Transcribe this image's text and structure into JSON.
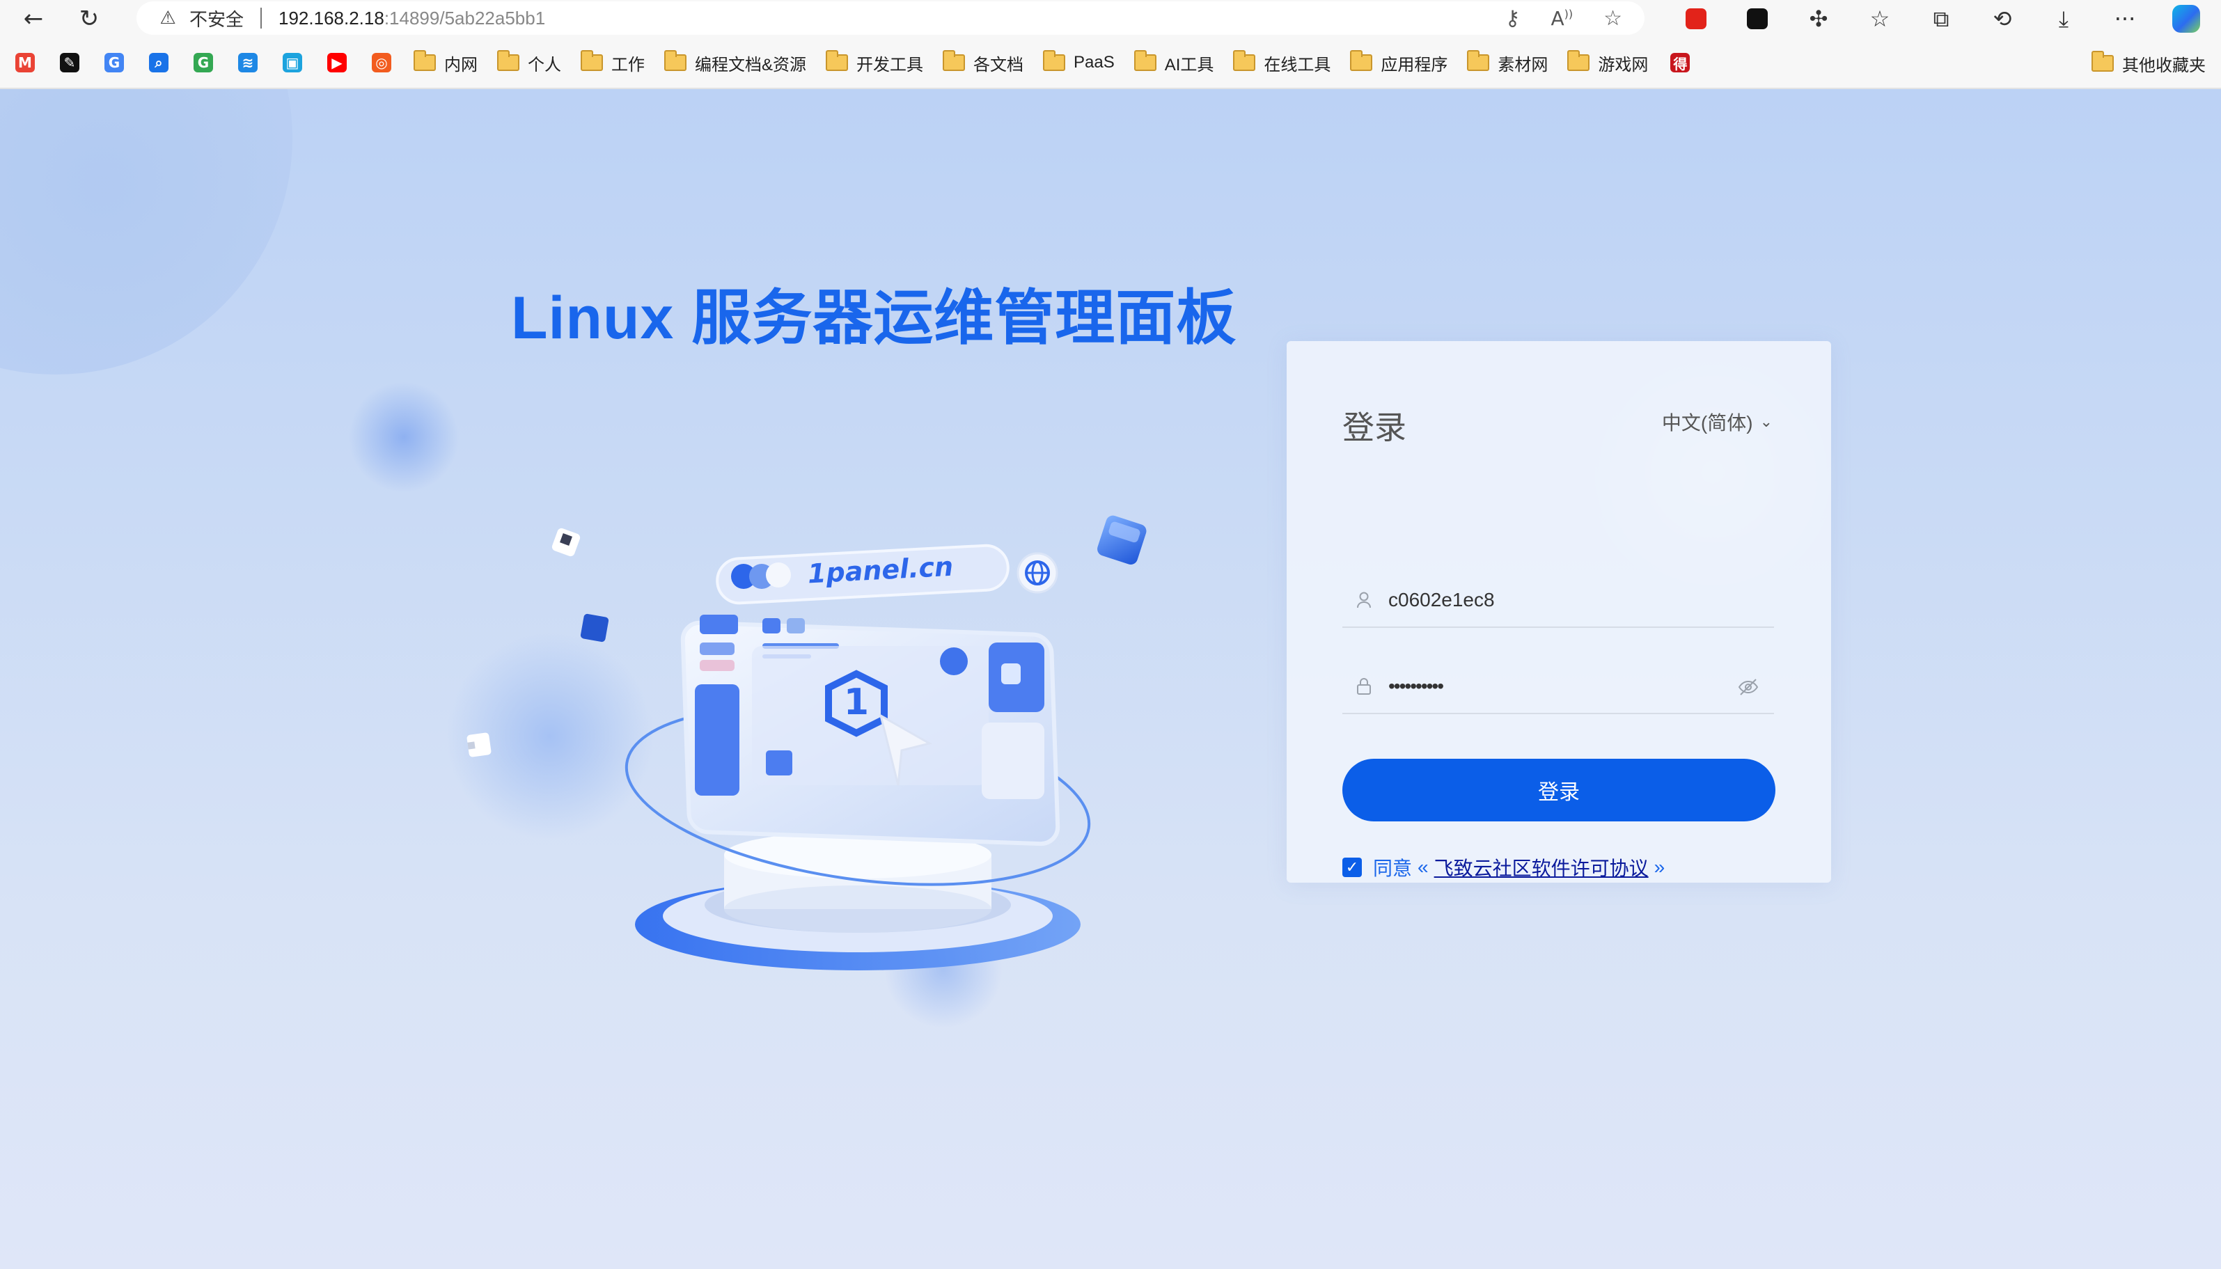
{
  "browser": {
    "address": {
      "security_label": "不安全",
      "host": "192.168.2.18",
      "path": ":14899/5ab22a5bb1"
    },
    "nav_icons": [
      "back-arrow-icon",
      "reload-icon"
    ],
    "address_icons": [
      "key-icon",
      "read-aloud-icon",
      "favorite-star-icon"
    ],
    "toolbar_icons": [
      "extension-red-icon",
      "extension-black-icon",
      "extensions-puzzle-icon",
      "favorites-icon",
      "collections-icon",
      "history-icon",
      "downloads-icon",
      "more-icon",
      "copilot-icon"
    ]
  },
  "bookmarks": {
    "favicons": [
      {
        "name": "gmail",
        "glyph": "M",
        "color": "#ea4335"
      },
      {
        "name": "bookmark-black",
        "glyph": "✎",
        "color": "#111111"
      },
      {
        "name": "translate",
        "glyph": "G",
        "color": "#4285f4"
      },
      {
        "name": "search",
        "glyph": "⌕",
        "color": "#1a73e8"
      },
      {
        "name": "google",
        "glyph": "G",
        "color": "#34a853"
      },
      {
        "name": "layers",
        "glyph": "≋",
        "color": "#1e88e5"
      },
      {
        "name": "bilibili",
        "glyph": "▣",
        "color": "#1ca3de"
      },
      {
        "name": "youtube",
        "glyph": "▶",
        "color": "#ff0000"
      },
      {
        "name": "app-orange",
        "glyph": "◎",
        "color": "#f25c1f"
      }
    ],
    "folders": [
      "内网",
      "个人",
      "工作",
      "编程文档&资源",
      "开发工具",
      "各文档",
      "PaaS",
      "AI工具",
      "在线工具",
      "应用程序",
      "素材网",
      "游戏网"
    ],
    "last_favicon": {
      "name": "de-red",
      "glyph": "得",
      "color": "#c8161d"
    },
    "other": "其他收藏夹"
  },
  "page": {
    "headline": "Linux 服务器运维管理面板",
    "illustration_label": "1panel.cn"
  },
  "login": {
    "title": "登录",
    "language": "中文(简体)",
    "username_value": "c0602e1ec8",
    "password_mask": "••••••••••",
    "submit_label": "登录",
    "agree_prefix": "同意",
    "agree_quote_open": "«",
    "agree_link": "飞致云社区软件许可协议",
    "agree_quote_close": "»",
    "agree_checked": true
  },
  "colors": {
    "accent": "#0b5ee8",
    "headline": "#1966ec",
    "background": "#c9daf5"
  }
}
